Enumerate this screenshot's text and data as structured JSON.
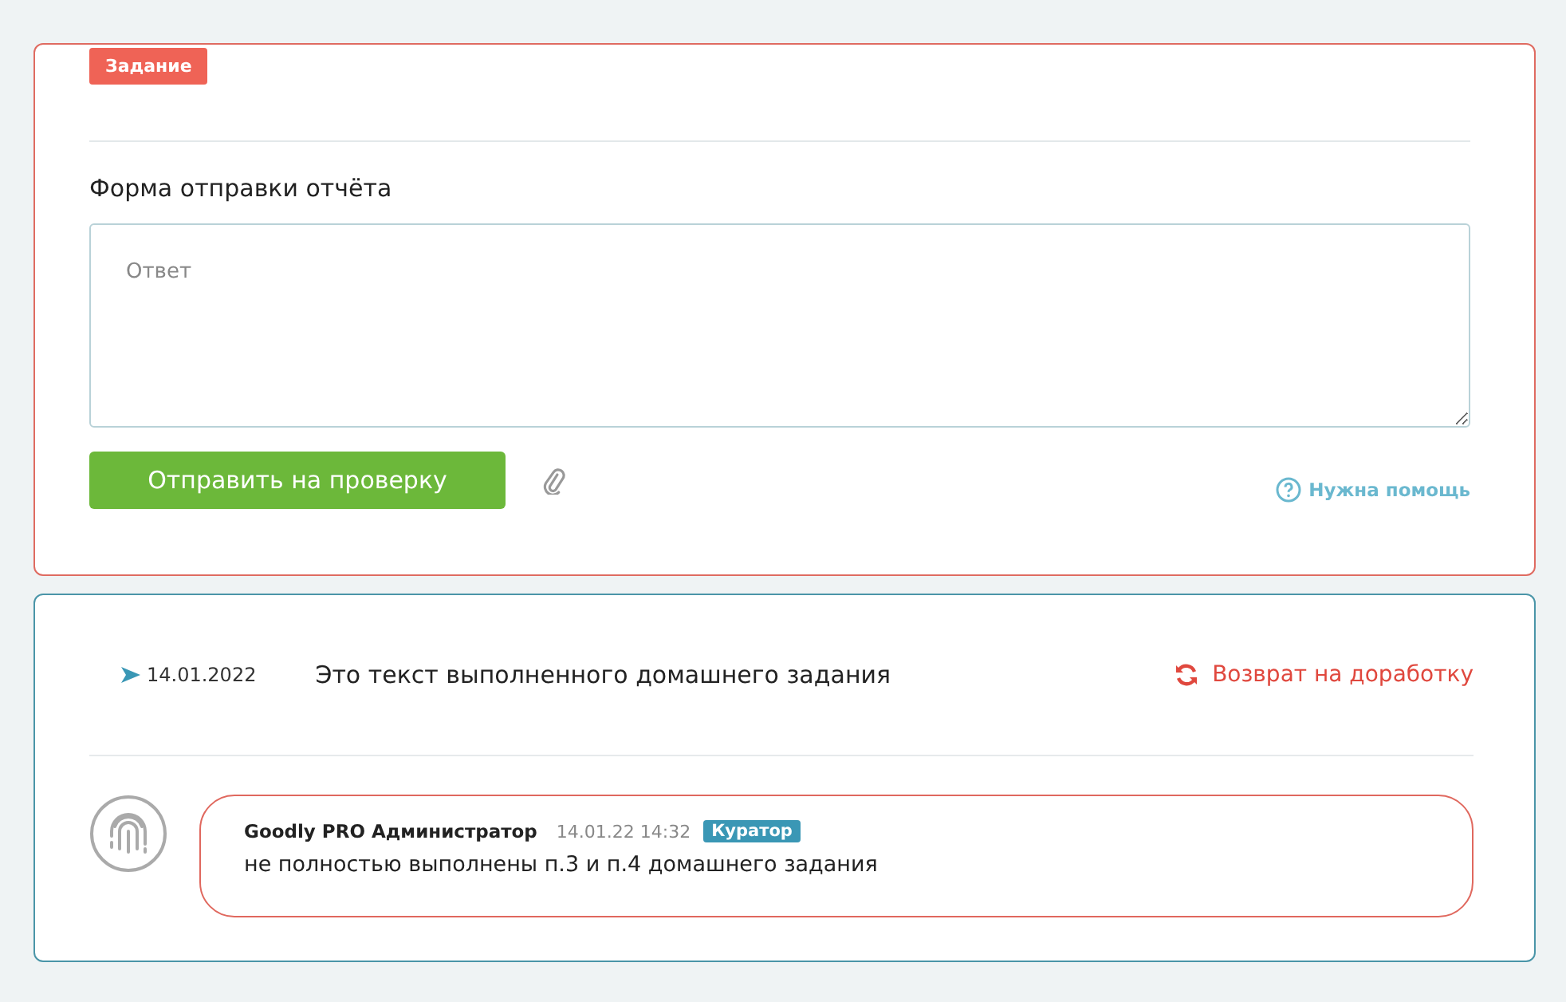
{
  "task": {
    "badge": "Задание",
    "form_title": "Форма отправки отчёта",
    "answer": {
      "placeholder": "Ответ"
    },
    "submit": "Отправить на проверку",
    "help": "Нужна помощь"
  },
  "report": {
    "date": "14.01.2022",
    "text": "Это текст выполненного домашнего задания",
    "action": "Возврат на доработку",
    "comments": [
      {
        "author": "Goodly PRO Администратор",
        "time": "14.01.22 14:32",
        "role": "Куратор",
        "text": "не полностью выполнены п.3 и п.4 домашнего задания"
      }
    ]
  }
}
